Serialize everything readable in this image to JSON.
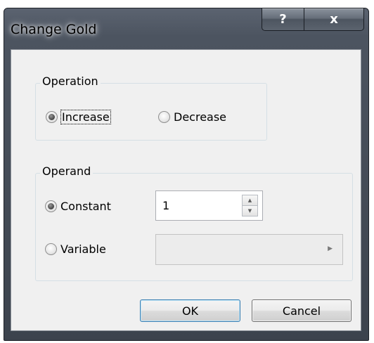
{
  "window": {
    "title": "Change Gold",
    "help_label": "?",
    "close_label": "x"
  },
  "operation": {
    "legend": "Operation",
    "options": [
      {
        "label": "Increase",
        "selected": true
      },
      {
        "label": "Decrease",
        "selected": false
      }
    ]
  },
  "operand": {
    "legend": "Operand",
    "constant": {
      "label": "Constant",
      "selected": true,
      "value": "1"
    },
    "variable": {
      "label": "Variable",
      "selected": false,
      "value": ""
    }
  },
  "buttons": {
    "ok_label": "OK",
    "cancel_label": "Cancel"
  },
  "icons": {
    "spin_up": "up-arrow-icon",
    "spin_down": "down-arrow-icon",
    "combo_open": "right-arrow-icon"
  },
  "colors": {
    "frame": "#4c5460",
    "client": "#f0f0f0",
    "default_button_border": "#3c7fb1"
  }
}
